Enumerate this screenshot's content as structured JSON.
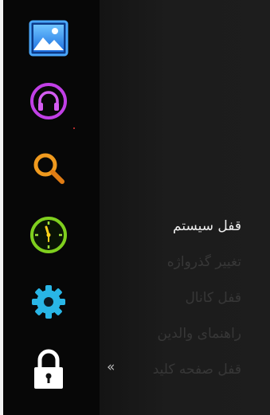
{
  "sidebar": {
    "icons": [
      {
        "name": "photos-icon",
        "color": "#2a8ff2"
      },
      {
        "name": "music-icon",
        "color": "#c940e8"
      },
      {
        "name": "search-icon",
        "color": "#e8921c"
      },
      {
        "name": "clock-icon",
        "color": "#8ad61c"
      },
      {
        "name": "settings-gear-icon",
        "color": "#27b7e0"
      },
      {
        "name": "lock-icon",
        "color": "#ffffff"
      }
    ]
  },
  "menu": {
    "items": [
      {
        "label": "قفل سیستم",
        "active": true
      },
      {
        "label": "تغییر گذرواژه",
        "active": false
      },
      {
        "label": "قفل کانال",
        "active": false
      },
      {
        "label": "راهنمای والدین",
        "active": false
      },
      {
        "label": "قفل صفحه کلید",
        "active": false
      }
    ],
    "expand_glyph": "«"
  }
}
